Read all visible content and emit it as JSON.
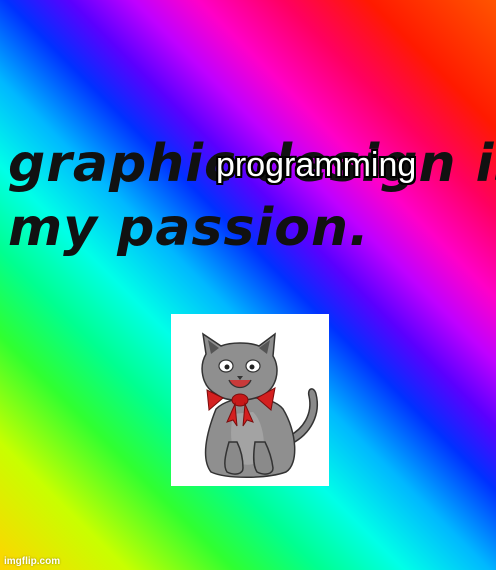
{
  "meme": {
    "caption_line1": "graphic design is",
    "caption_line2": "my passion.",
    "overlay_text": "programming",
    "image": "cat-with-red-bow",
    "watermark": "imgflip.com"
  },
  "colors": {
    "caption": "#111111",
    "overlay_text": "#ffffff",
    "overlay_outline": "#000000",
    "cat_fur": "#8a8a8a",
    "bow": "#d42020",
    "image_background": "#ffffff"
  }
}
